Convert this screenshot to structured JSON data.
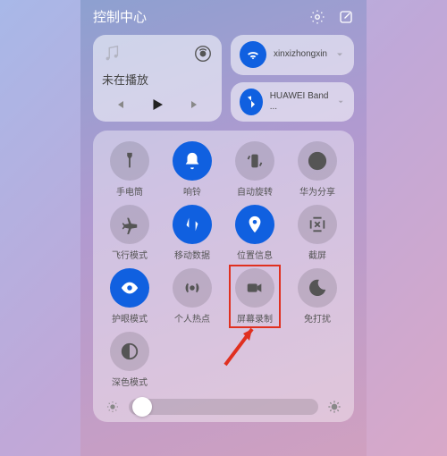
{
  "header": {
    "title": "控制中心"
  },
  "media": {
    "not_playing": "未在播放"
  },
  "conn": {
    "wifi_name": "xinxizhongxin",
    "bt_name": "HUAWEI Band ..."
  },
  "tiles": [
    {
      "label": "手电筒"
    },
    {
      "label": "响铃"
    },
    {
      "label": "自动旋转"
    },
    {
      "label": "华为分享"
    },
    {
      "label": "飞行模式"
    },
    {
      "label": "移动数据"
    },
    {
      "label": "位置信息"
    },
    {
      "label": "截屏"
    },
    {
      "label": "护眼模式"
    },
    {
      "label": "个人热点"
    },
    {
      "label": "屏幕录制"
    },
    {
      "label": "免打扰"
    },
    {
      "label": "深色模式"
    }
  ]
}
